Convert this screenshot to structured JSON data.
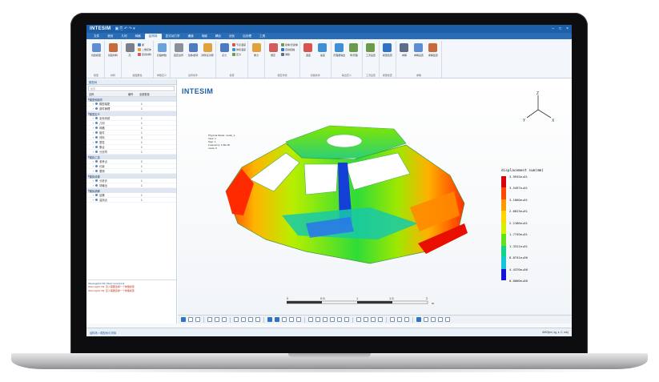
{
  "app": {
    "brand": "INTESIM",
    "window_controls": [
      "–",
      "□",
      "×"
    ]
  },
  "menu": {
    "tabs": [
      "文件",
      "首页",
      "几何",
      "网格",
      "结构场",
      "显式动力学",
      "通道",
      "电磁",
      "耦合",
      "优化",
      "后处理",
      "工具"
    ],
    "active_index": 4
  },
  "ribbon": {
    "groups": [
      {
        "label": "模型",
        "buttons": [
          "创建模型"
        ],
        "small": []
      },
      {
        "label": "材料",
        "buttons": [
          "创建材料"
        ],
        "small": []
      },
      {
        "label": "截面属性",
        "buttons": [
          "壳"
        ],
        "small": [
          "梁",
          "二维实体",
          "复合材料"
        ]
      },
      {
        "label": "参数定义",
        "buttons": [
          "扫描参数"
        ],
        "small": []
      },
      {
        "label": "边界条件",
        "buttons": [
          "固定边界",
          "位移/旋转",
          "对称/反对称"
        ],
        "small": []
      },
      {
        "label": "载荷",
        "buttons": [
          "点力"
        ],
        "small": [
          "节点温度",
          "体积温度",
          "压力"
        ]
      },
      {
        "label": "",
        "buttons": [
          "重力"
        ],
        "small": []
      },
      {
        "label": "相互作用",
        "buttons": [
          "绑定"
        ],
        "small": [
          "摩擦/无摩擦",
          "自动接触",
          "滑移"
        ]
      },
      {
        "label": "初始条件",
        "buttons": [
          "温度",
          "速度"
        ],
        "small": []
      },
      {
        "label": "输出定义",
        "buttons": [
          "历程量输出",
          "场/历程"
        ],
        "small": []
      },
      {
        "label": "工况设置",
        "buttons": [
          "工况设置"
        ],
        "small": []
      },
      {
        "label": "模型检查",
        "buttons": [
          "模型检查"
        ],
        "small": []
      },
      {
        "label": "求解",
        "buttons": [
          "求解",
          "求解设置",
          "求解监控"
        ],
        "small": []
      }
    ]
  },
  "left_panel": {
    "tab": "模型树",
    "search_placeholder": "搜索...",
    "columns": [
      "名称",
      "编号",
      "全部数量"
    ],
    "groups": [
      {
        "name": "模型和部件",
        "items": [
          {
            "name": "模型装配",
            "count": "1"
          },
          {
            "name": "部件管理",
            "count": "1"
          }
        ]
      },
      {
        "name": "模型定义",
        "items": [
          {
            "name": "坐标系统",
            "count": "1"
          },
          {
            "name": "几何",
            "count": "1"
          },
          {
            "name": "网格",
            "count": "1"
          },
          {
            "name": "组件",
            "count": "1"
          },
          {
            "name": "材料",
            "count": "3"
          },
          {
            "name": "属性",
            "count": "1"
          },
          {
            "name": "集合",
            "count": "1"
          },
          {
            "name": "分页符",
            "count": "1"
          }
        ]
      },
      {
        "name": "模拟工具",
        "items": [
          {
            "name": "参考点",
            "count": "2"
          },
          {
            "name": "约束",
            "count": "1"
          },
          {
            "name": "载荷",
            "count": "1"
          }
        ]
      },
      {
        "name": "模拟设置",
        "items": [
          {
            "name": "分析步",
            "count": "1"
          },
          {
            "name": "场输出",
            "count": "1"
          }
        ]
      },
      {
        "name": "模拟求解",
        "items": [
          {
            "name": "结果",
            "count": "1"
          },
          {
            "name": "监测点",
            "count": "1"
          }
        ]
      }
    ]
  },
  "messages": [
    "Message[10:33]: Mesh Count(4.0)",
    "Warning[10:33]: 至少需要选择一个物理模型",
    "Warning[10:33]: 至少需要选择一个物理模型"
  ],
  "viewport": {
    "logo": "INTESIM",
    "info_lines": [
      "Physical Model: model_1",
      "View: 1",
      "Step: 1",
      "Frequency: 1.0E+00",
      "mode: 0"
    ],
    "legend_title": "displacement sum(mm)",
    "legend_values": [
      "3.9935e+01",
      "3.5497e+01",
      "3.1060e+01",
      "2.6623e+01",
      "2.2186e+01",
      "1.7749e+01",
      "1.3311e+01",
      "8.8741e+00",
      "4.4370e+00",
      "0.0000e+00"
    ],
    "legend_colors": [
      "#d9000c",
      "#ff4a00",
      "#ff9a00",
      "#ffd400",
      "#d4f200",
      "#63e21b",
      "#12d38a",
      "#13c6d9",
      "#1a73f0",
      "#1515d8"
    ],
    "scale_ticks": [
      "0",
      "0.5",
      "1",
      "1.5",
      "2"
    ],
    "scale_unit": "m",
    "axis_labels": [
      "Z",
      "Y",
      "X"
    ]
  },
  "statusbar": {
    "left": "结构场 > 模型树/几何体",
    "right": "400D(km, kg, s, C, mA)"
  }
}
